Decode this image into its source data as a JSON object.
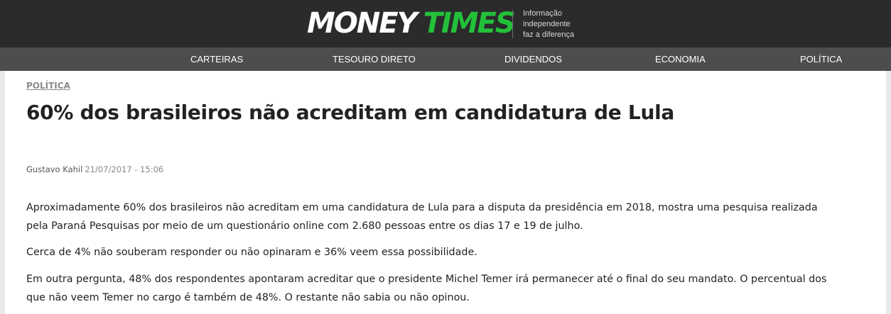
{
  "header": {
    "logo_money": "MONEY",
    "logo_times": "TIMES",
    "tagline": [
      "Informação",
      "independente",
      "faz a diferença"
    ]
  },
  "nav": {
    "items": [
      {
        "label": "CARTEIRAS"
      },
      {
        "label": "TESOURO DIRETO"
      },
      {
        "label": "DIVIDENDOS"
      },
      {
        "label": "ECONOMIA"
      },
      {
        "label": "POLÍTICA"
      }
    ]
  },
  "article": {
    "category": "POLÍTICA",
    "title": "60% dos brasileiros não acreditam em candidatura de Lula",
    "author": "Gustavo Kahil",
    "datetime": "21/07/2017 - 15:06",
    "paragraphs": [
      {
        "lines": [
          "Aproximadamente 60% dos brasileiros não acreditam em uma candidatura de Lula para a disputa da presidência em 2018, mostra uma pesquisa realizada",
          "pela Paraná Pesquisas por meio de um questionário online com 2.680 pessoas entre os dias 17 e 19 de julho."
        ]
      },
      {
        "lines": [
          "Cerca de 4% não souberam responder ou não opinaram e 36% veem essa possibilidade."
        ]
      },
      {
        "lines": [
          "Em outra pergunta, 48% dos respondentes apontaram acreditar que o presidente Michel Temer irá permanecer até o final do seu mandato. O percentual dos",
          "que não veem Temer no cargo é também de 48%. O restante não sabia ou não opinou."
        ]
      }
    ]
  },
  "colors": {
    "topbar_bg": "#2b2b2b",
    "navbar_bg": "#4d4d4d",
    "brand_green": "#23c03a",
    "page_bg": "#e9e9e9"
  }
}
